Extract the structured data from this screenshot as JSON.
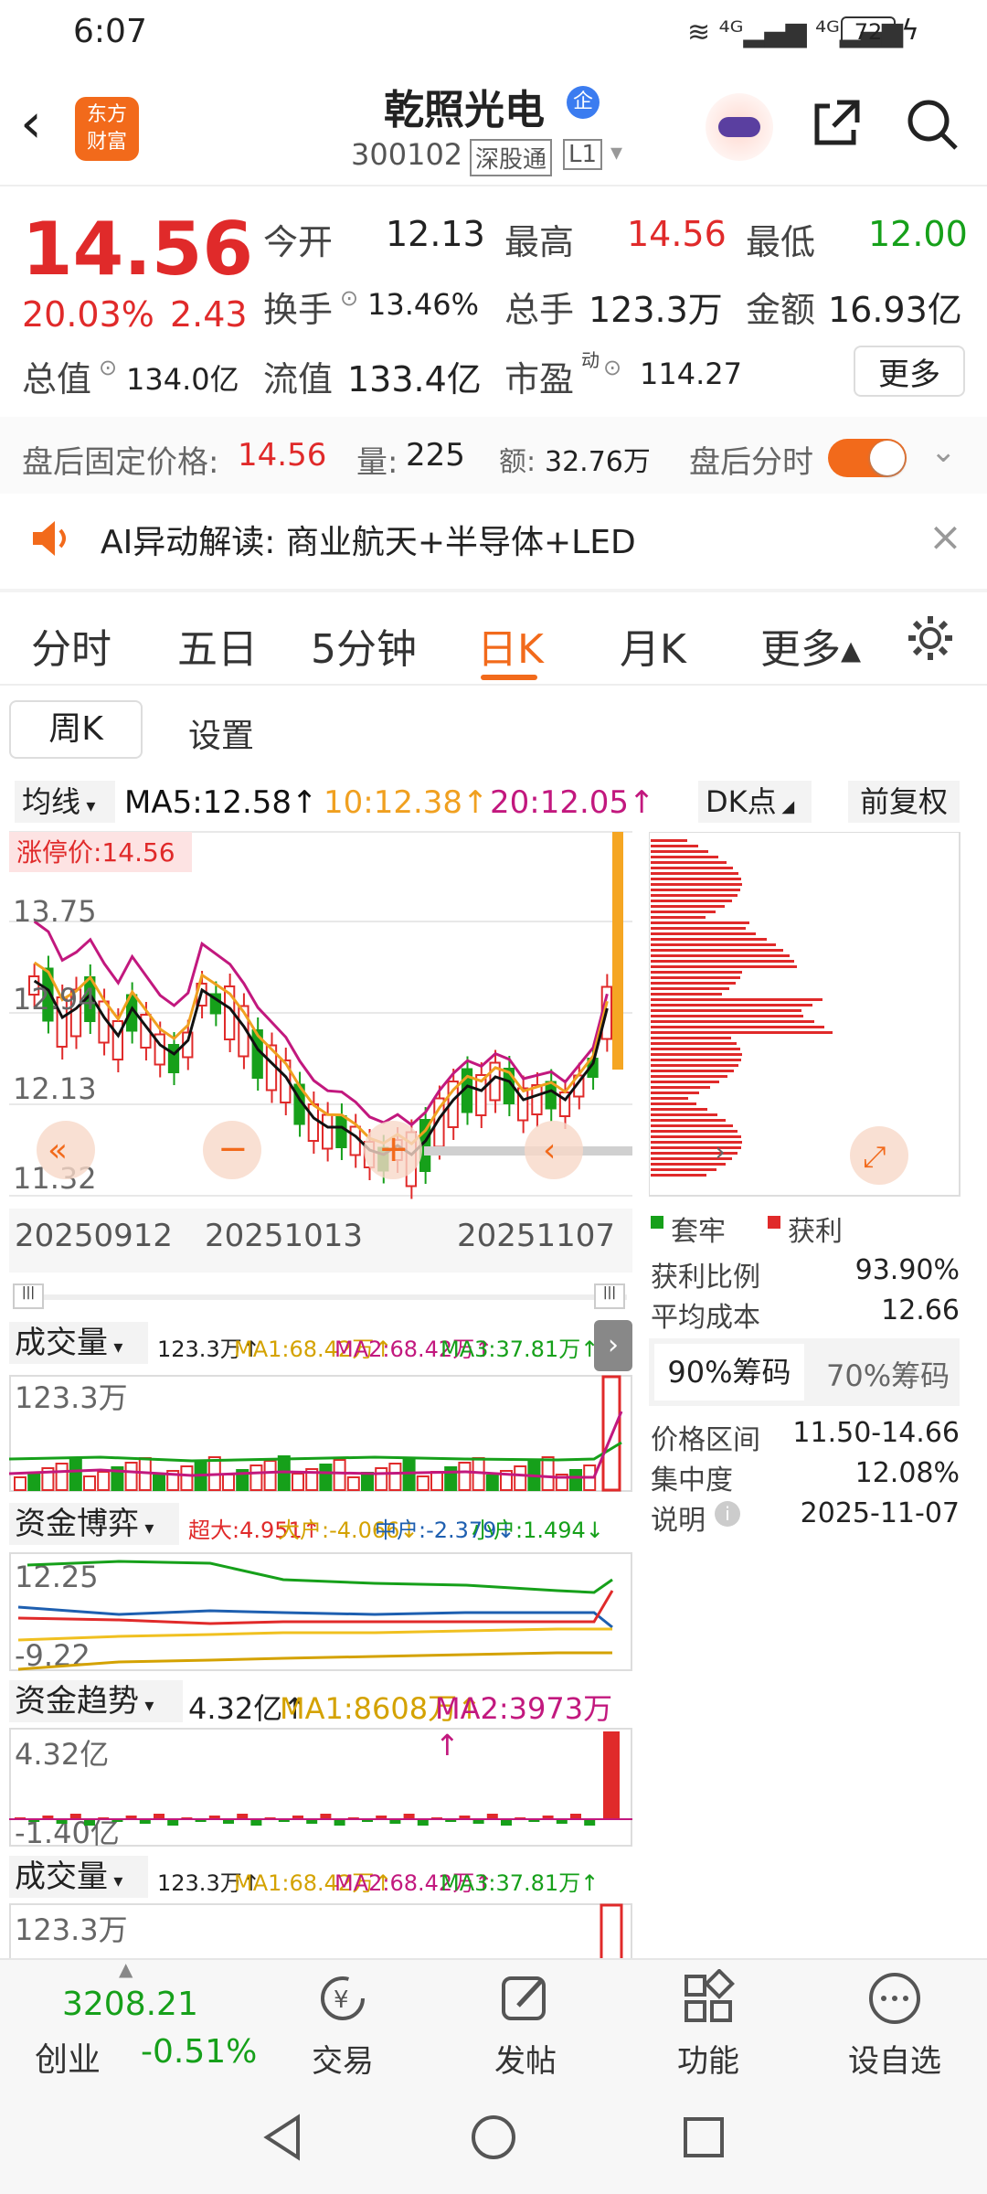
{
  "status": {
    "time": "6:07",
    "battery": "72"
  },
  "header": {
    "stock_name": "乾照光电",
    "badge": "企",
    "code": "300102",
    "tag1": "深股通",
    "tag2": "L1",
    "logo_line1": "东方",
    "logo_line2": "财富"
  },
  "quote": {
    "price": "14.56",
    "pct": "20.03%",
    "chg": "2.43",
    "open_label": "今开",
    "open": "12.13",
    "high_label": "最高",
    "high": "14.56",
    "low_label": "最低",
    "low": "12.00",
    "turnover_label": "换手",
    "turnover": "13.46%",
    "volume_label": "总手",
    "volume": "123.3万",
    "amount_label": "金额",
    "amount": "16.93亿",
    "mcap_label": "总值",
    "mcap": "134.0亿",
    "float_label": "流值",
    "float": "133.4亿",
    "pe_label": "市盈",
    "pe_sup": "动",
    "pe": "114.27",
    "more": "更多"
  },
  "afterhours": {
    "price_label": "盘后固定价格:",
    "price": "14.56",
    "qty_label": "量:",
    "qty": "225",
    "amt_label": "额:",
    "amt": "32.76万",
    "toggle_label": "盘后分时"
  },
  "ai": {
    "text": "AI异动解读:  商业航天+半导体+LED"
  },
  "tabs": [
    "分时",
    "五日",
    "5分钟",
    "日K",
    "月K",
    "更多▴"
  ],
  "subtabs": {
    "week": "周K",
    "settings": "设置"
  },
  "ma": {
    "selector": "均线",
    "ma5": "MA5:12.58↑",
    "ma10": "10:12.38↑",
    "ma20": "20:12.05↑",
    "dk": "DK点",
    "adj": "前复权"
  },
  "kchart": {
    "limit_label": "涨停价:14.56",
    "y_labels": [
      "13.75",
      "12.94",
      "12.13",
      "11.32"
    ],
    "x_labels": [
      "20250912",
      "20251013",
      "20251107"
    ]
  },
  "chips": {
    "legend_tight": "套牢",
    "legend_profit": "获利",
    "profit_ratio_label": "获利比例",
    "profit_ratio": "93.90%",
    "avg_cost_label": "平均成本",
    "avg_cost": "12.66",
    "tab90": "90%筹码",
    "tab70": "70%筹码",
    "range_label": "价格区间",
    "range": "11.50-14.66",
    "conc_label": "集中度",
    "conc": "12.08%",
    "note_label": "说明",
    "note": "2025-11-07"
  },
  "vol": {
    "title": "成交量",
    "value": "123.3万↑",
    "ma1": "MA1:68.42万↑",
    "ma2": "MA2:68.42万↑",
    "ma3": "MA3:37.81万↑",
    "ylabel": "123.3万"
  },
  "fund_game": {
    "title": "资金博弈",
    "super": "超大:4.951↑",
    "big": "大户:-4.066↓",
    "mid": "中户:-2.379↓",
    "small": "小户:1.494↓",
    "ytop": "12.25",
    "ybot": "-9.22"
  },
  "fund_trend": {
    "title": "资金趋势",
    "value": "4.32亿↑",
    "ma1": "MA1:8608万↑",
    "ma2": "MA2:3973万↑",
    "ytop": "4.32亿",
    "ybot": "-1.40亿"
  },
  "vol2": {
    "title": "成交量",
    "value": "123.3万↑",
    "ma1": "MA1:68.42万↑",
    "ma2": "MA2:68.42万↑",
    "ma3": "MA3:37.81万↑",
    "ylabel": "123.3万"
  },
  "bottom": {
    "index_value": "3208.21",
    "index_name": "创业",
    "index_pct": "-0.51%",
    "trade": "交易",
    "post": "发帖",
    "func": "功能",
    "watch": "设自选"
  },
  "colors": {
    "up": "#e02a2a",
    "down": "#16a01a",
    "accent": "#f26a1b",
    "ma5": "#111111",
    "ma10": "#f0a020",
    "ma20": "#c2187e"
  }
}
